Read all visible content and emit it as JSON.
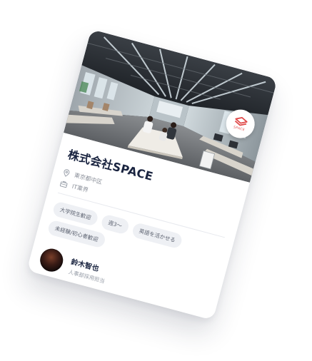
{
  "company": {
    "name": "株式会社SPACE",
    "location": "東京都中区",
    "industry": "IT業界",
    "logo_text": "SPACE"
  },
  "tags": [
    "大学院生歓迎",
    "週3〜",
    "英語を活かせる",
    "未経験/初心者歓迎"
  ],
  "recruiter": {
    "name": "鈴木智也",
    "role": "人事部採用担当"
  },
  "colors": {
    "brand": "#e04a4a",
    "title": "#1a2440",
    "tag_bg": "#eef0f4"
  }
}
